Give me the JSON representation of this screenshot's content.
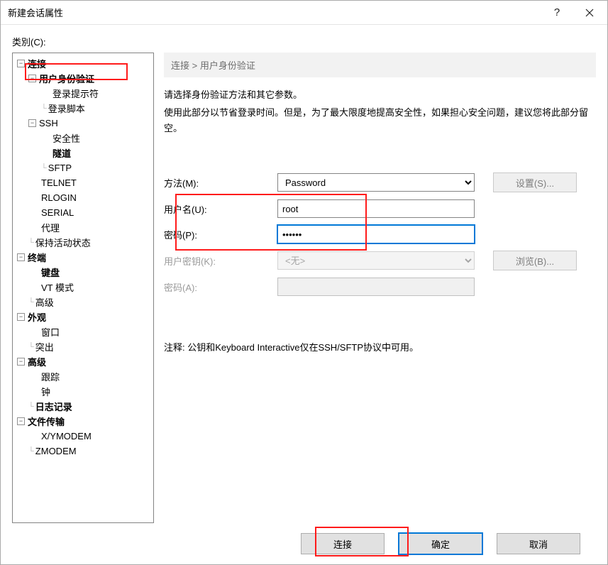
{
  "titlebar": {
    "title": "新建会话属性"
  },
  "category_label": "类別(C):",
  "tree": {
    "connection": "连接",
    "auth": "用户身份验证",
    "login_prompt": "登录提示符",
    "login_script": "登录脚本",
    "ssh": "SSH",
    "security": "安全性",
    "tunnel": "隧道",
    "sftp": "SFTP",
    "telnet": "TELNET",
    "rlogin": "RLOGIN",
    "serial": "SERIAL",
    "proxy": "代理",
    "keepalive": "保持活动状态",
    "terminal": "终端",
    "keyboard": "键盘",
    "vt": "VT 模式",
    "term_adv": "高级",
    "appearance": "外观",
    "window": "窗口",
    "highlight": "突出",
    "advanced": "高级",
    "trace": "跟踪",
    "bell": "钟",
    "logging": "日志记录",
    "file_transfer": "文件传输",
    "xymodem": "X/YMODEM",
    "zmodem": "ZMODEM"
  },
  "breadcrumb": "连接 > 用户身份验证",
  "intro1": "请选择身份验证方法和其它参数。",
  "intro2": "使用此部分以节省登录时间。但是，为了最大限度地提高安全性，如果担心安全问题，建议您将此部分留空。",
  "form": {
    "method_label": "方法(M):",
    "method_value": "Password",
    "settings_btn": "设置(S)...",
    "username_label": "用户名(U):",
    "username_value": "root",
    "password_label": "密码(P):",
    "password_value": "••••••",
    "userkey_label": "用户密钥(K):",
    "userkey_value": "<无>",
    "browse_btn": "浏览(B)...",
    "passphrase_label": "密码(A):"
  },
  "note": "注释: 公钥和Keyboard Interactive仅在SSH/SFTP协议中可用。",
  "buttons": {
    "connect": "连接",
    "ok": "确定",
    "cancel": "取消"
  }
}
